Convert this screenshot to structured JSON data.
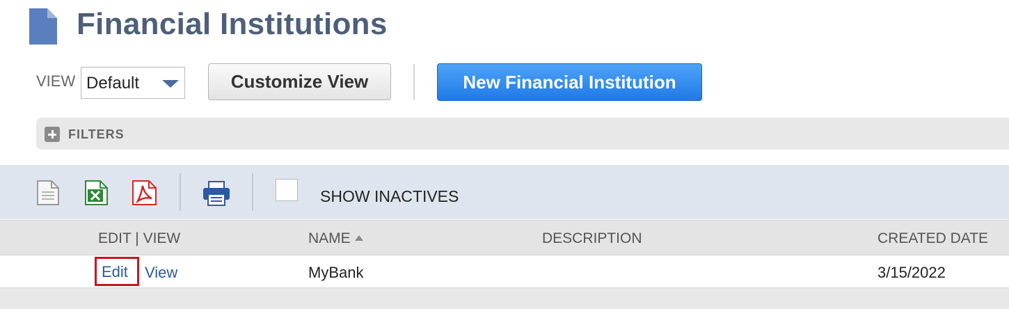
{
  "page": {
    "title": "Financial Institutions",
    "icon": "document-icon"
  },
  "view": {
    "label": "VIEW",
    "selected": "Default"
  },
  "buttons": {
    "customize_view": "Customize View",
    "new_financial_institution": "New Financial Institution"
  },
  "filters": {
    "label": "FILTERS"
  },
  "toolbar": {
    "icons": [
      "new-document-icon",
      "excel-export-icon",
      "pdf-export-icon",
      "print-icon"
    ],
    "show_inactives_label": "SHOW INACTIVES",
    "show_inactives_checked": false
  },
  "table": {
    "columns": {
      "edit_view": "EDIT | VIEW",
      "name": "NAME",
      "description": "DESCRIPTION",
      "created_date": "CREATED DATE"
    },
    "sort": {
      "column": "name",
      "direction": "ascending"
    },
    "rows": [
      {
        "edit_label": "Edit",
        "view_label": "View",
        "name": "MyBank",
        "description": "",
        "created_date": "3/15/2022"
      }
    ]
  },
  "colors": {
    "title": "#4d5f79",
    "primary_button": "#2a84ef",
    "link": "#2a5b9c",
    "highlight_box": "#c8161d",
    "toolbar_bg": "#dfe5ee"
  }
}
